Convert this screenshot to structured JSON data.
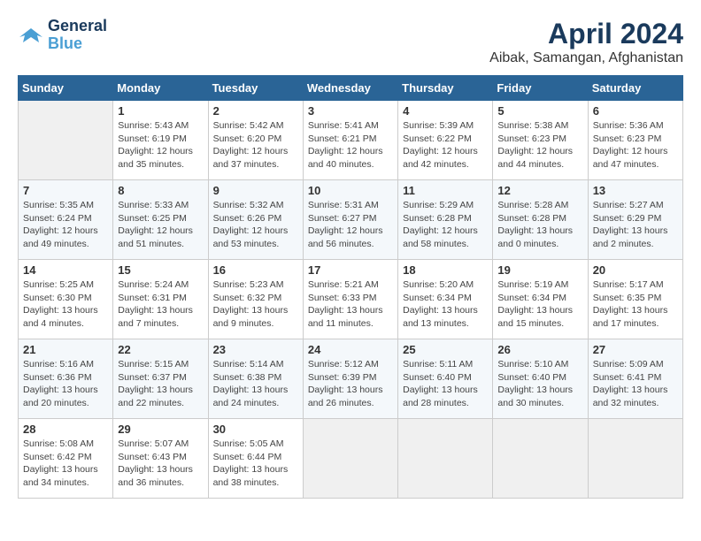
{
  "logo": {
    "line1": "General",
    "line2": "Blue"
  },
  "title": "April 2024",
  "location": "Aibak, Samangan, Afghanistan",
  "days_of_week": [
    "Sunday",
    "Monday",
    "Tuesday",
    "Wednesday",
    "Thursday",
    "Friday",
    "Saturday"
  ],
  "weeks": [
    [
      {
        "day": "",
        "sunrise": "",
        "sunset": "",
        "daylight": ""
      },
      {
        "day": "1",
        "sunrise": "Sunrise: 5:43 AM",
        "sunset": "Sunset: 6:19 PM",
        "daylight": "Daylight: 12 hours and 35 minutes."
      },
      {
        "day": "2",
        "sunrise": "Sunrise: 5:42 AM",
        "sunset": "Sunset: 6:20 PM",
        "daylight": "Daylight: 12 hours and 37 minutes."
      },
      {
        "day": "3",
        "sunrise": "Sunrise: 5:41 AM",
        "sunset": "Sunset: 6:21 PM",
        "daylight": "Daylight: 12 hours and 40 minutes."
      },
      {
        "day": "4",
        "sunrise": "Sunrise: 5:39 AM",
        "sunset": "Sunset: 6:22 PM",
        "daylight": "Daylight: 12 hours and 42 minutes."
      },
      {
        "day": "5",
        "sunrise": "Sunrise: 5:38 AM",
        "sunset": "Sunset: 6:23 PM",
        "daylight": "Daylight: 12 hours and 44 minutes."
      },
      {
        "day": "6",
        "sunrise": "Sunrise: 5:36 AM",
        "sunset": "Sunset: 6:23 PM",
        "daylight": "Daylight: 12 hours and 47 minutes."
      }
    ],
    [
      {
        "day": "7",
        "sunrise": "Sunrise: 5:35 AM",
        "sunset": "Sunset: 6:24 PM",
        "daylight": "Daylight: 12 hours and 49 minutes."
      },
      {
        "day": "8",
        "sunrise": "Sunrise: 5:33 AM",
        "sunset": "Sunset: 6:25 PM",
        "daylight": "Daylight: 12 hours and 51 minutes."
      },
      {
        "day": "9",
        "sunrise": "Sunrise: 5:32 AM",
        "sunset": "Sunset: 6:26 PM",
        "daylight": "Daylight: 12 hours and 53 minutes."
      },
      {
        "day": "10",
        "sunrise": "Sunrise: 5:31 AM",
        "sunset": "Sunset: 6:27 PM",
        "daylight": "Daylight: 12 hours and 56 minutes."
      },
      {
        "day": "11",
        "sunrise": "Sunrise: 5:29 AM",
        "sunset": "Sunset: 6:28 PM",
        "daylight": "Daylight: 12 hours and 58 minutes."
      },
      {
        "day": "12",
        "sunrise": "Sunrise: 5:28 AM",
        "sunset": "Sunset: 6:28 PM",
        "daylight": "Daylight: 13 hours and 0 minutes."
      },
      {
        "day": "13",
        "sunrise": "Sunrise: 5:27 AM",
        "sunset": "Sunset: 6:29 PM",
        "daylight": "Daylight: 13 hours and 2 minutes."
      }
    ],
    [
      {
        "day": "14",
        "sunrise": "Sunrise: 5:25 AM",
        "sunset": "Sunset: 6:30 PM",
        "daylight": "Daylight: 13 hours and 4 minutes."
      },
      {
        "day": "15",
        "sunrise": "Sunrise: 5:24 AM",
        "sunset": "Sunset: 6:31 PM",
        "daylight": "Daylight: 13 hours and 7 minutes."
      },
      {
        "day": "16",
        "sunrise": "Sunrise: 5:23 AM",
        "sunset": "Sunset: 6:32 PM",
        "daylight": "Daylight: 13 hours and 9 minutes."
      },
      {
        "day": "17",
        "sunrise": "Sunrise: 5:21 AM",
        "sunset": "Sunset: 6:33 PM",
        "daylight": "Daylight: 13 hours and 11 minutes."
      },
      {
        "day": "18",
        "sunrise": "Sunrise: 5:20 AM",
        "sunset": "Sunset: 6:34 PM",
        "daylight": "Daylight: 13 hours and 13 minutes."
      },
      {
        "day": "19",
        "sunrise": "Sunrise: 5:19 AM",
        "sunset": "Sunset: 6:34 PM",
        "daylight": "Daylight: 13 hours and 15 minutes."
      },
      {
        "day": "20",
        "sunrise": "Sunrise: 5:17 AM",
        "sunset": "Sunset: 6:35 PM",
        "daylight": "Daylight: 13 hours and 17 minutes."
      }
    ],
    [
      {
        "day": "21",
        "sunrise": "Sunrise: 5:16 AM",
        "sunset": "Sunset: 6:36 PM",
        "daylight": "Daylight: 13 hours and 20 minutes."
      },
      {
        "day": "22",
        "sunrise": "Sunrise: 5:15 AM",
        "sunset": "Sunset: 6:37 PM",
        "daylight": "Daylight: 13 hours and 22 minutes."
      },
      {
        "day": "23",
        "sunrise": "Sunrise: 5:14 AM",
        "sunset": "Sunset: 6:38 PM",
        "daylight": "Daylight: 13 hours and 24 minutes."
      },
      {
        "day": "24",
        "sunrise": "Sunrise: 5:12 AM",
        "sunset": "Sunset: 6:39 PM",
        "daylight": "Daylight: 13 hours and 26 minutes."
      },
      {
        "day": "25",
        "sunrise": "Sunrise: 5:11 AM",
        "sunset": "Sunset: 6:40 PM",
        "daylight": "Daylight: 13 hours and 28 minutes."
      },
      {
        "day": "26",
        "sunrise": "Sunrise: 5:10 AM",
        "sunset": "Sunset: 6:40 PM",
        "daylight": "Daylight: 13 hours and 30 minutes."
      },
      {
        "day": "27",
        "sunrise": "Sunrise: 5:09 AM",
        "sunset": "Sunset: 6:41 PM",
        "daylight": "Daylight: 13 hours and 32 minutes."
      }
    ],
    [
      {
        "day": "28",
        "sunrise": "Sunrise: 5:08 AM",
        "sunset": "Sunset: 6:42 PM",
        "daylight": "Daylight: 13 hours and 34 minutes."
      },
      {
        "day": "29",
        "sunrise": "Sunrise: 5:07 AM",
        "sunset": "Sunset: 6:43 PM",
        "daylight": "Daylight: 13 hours and 36 minutes."
      },
      {
        "day": "30",
        "sunrise": "Sunrise: 5:05 AM",
        "sunset": "Sunset: 6:44 PM",
        "daylight": "Daylight: 13 hours and 38 minutes."
      },
      {
        "day": "",
        "sunrise": "",
        "sunset": "",
        "daylight": ""
      },
      {
        "day": "",
        "sunrise": "",
        "sunset": "",
        "daylight": ""
      },
      {
        "day": "",
        "sunrise": "",
        "sunset": "",
        "daylight": ""
      },
      {
        "day": "",
        "sunrise": "",
        "sunset": "",
        "daylight": ""
      }
    ]
  ]
}
